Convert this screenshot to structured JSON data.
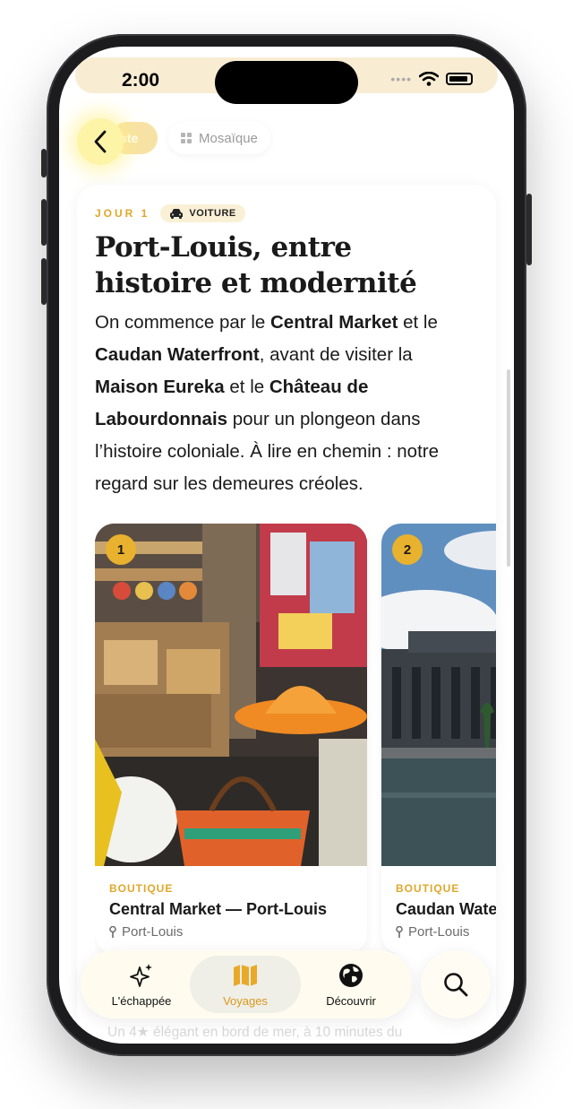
{
  "status_bar": {
    "time": "2:00"
  },
  "view_toggle": {
    "liste_label": "ste",
    "mosaique_label": "Mosaïque"
  },
  "day": {
    "label": "JOUR 1",
    "transport": "VOITURE",
    "title": "Port-Louis, entre histoire et modernité",
    "description": {
      "p1": "On commence par le ",
      "b1": "Central Market",
      "p2": " et le ",
      "b2": "Caudan Waterfront",
      "p3": ", avant de visiter la ",
      "b3": "Maison Eureka",
      "p4": " et le ",
      "b4": "Château de Labourdonnais",
      "p5": " pour un plongeon dans l’histoire coloniale. À lire en chemin : notre regard sur les demeures créoles."
    }
  },
  "places": [
    {
      "number": "1",
      "category": "BOUTIQUE",
      "name": "Central Market — Port-Louis",
      "location": "Port-Louis"
    },
    {
      "number": "2",
      "category": "BOUTIQUE",
      "name": "Caudan Waterfront",
      "location": "Port-Louis"
    }
  ],
  "tabs": [
    {
      "label": "L'échappée",
      "icon": "sparkles-icon"
    },
    {
      "label": "Voyages",
      "icon": "map-icon"
    },
    {
      "label": "Découvrir",
      "icon": "globe-icon"
    }
  ],
  "below_fold_text": "Un 4★ élégant en bord de mer, à 10 minutes du",
  "colors": {
    "accent": "#e0a72b",
    "active_tab": "#d99a1d",
    "status_bar_bg": "#f8ecd3"
  }
}
